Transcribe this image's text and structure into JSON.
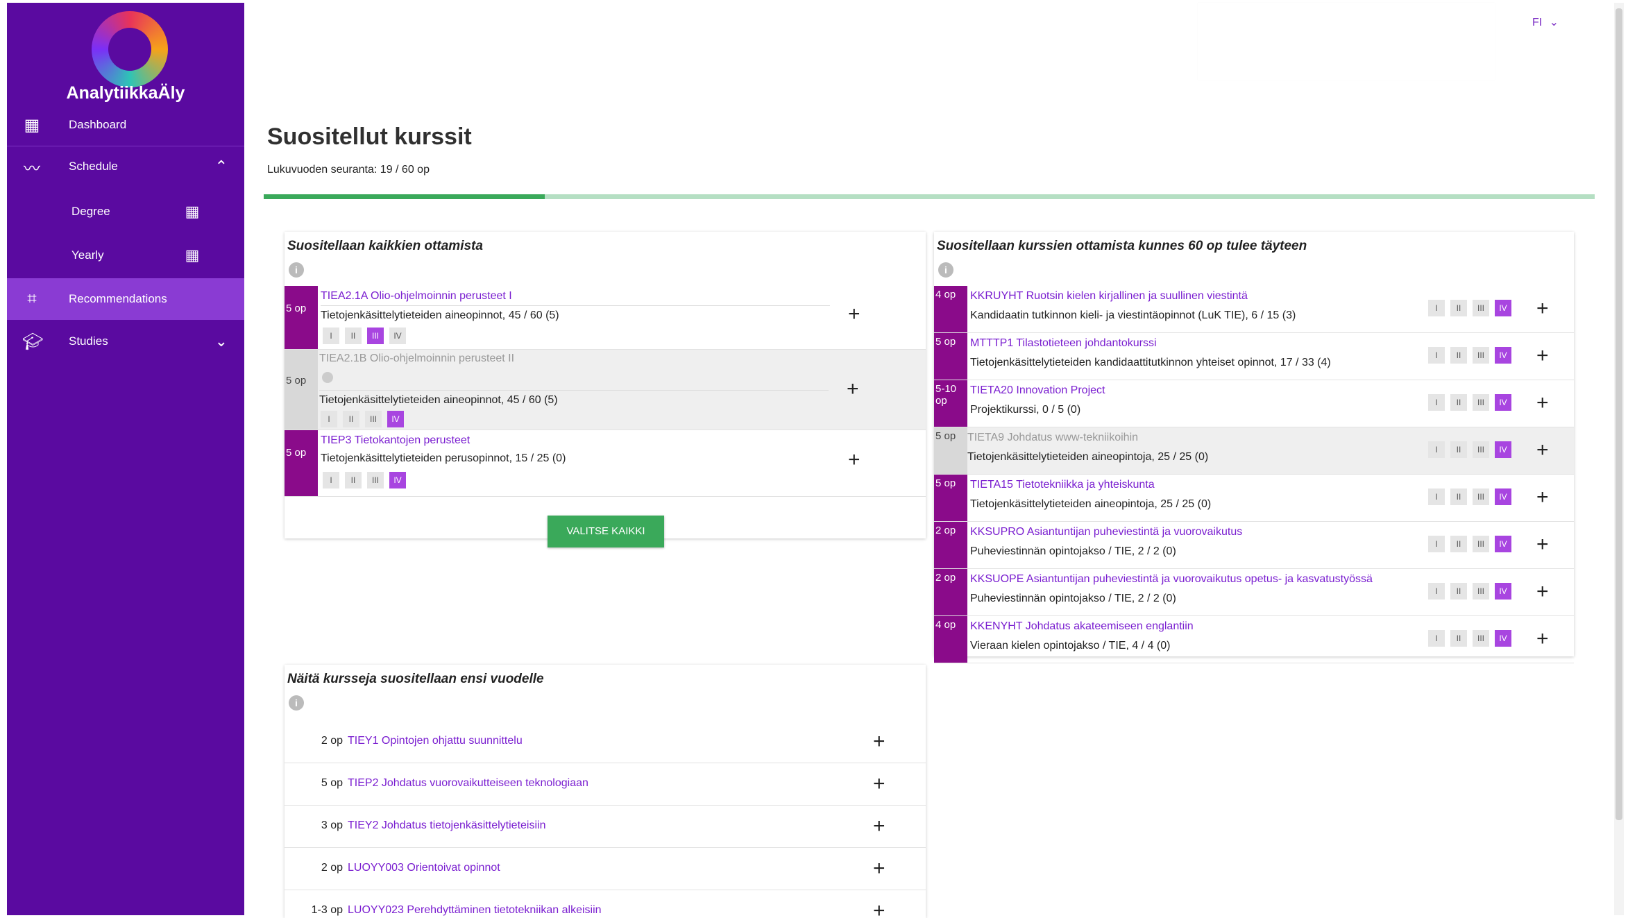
{
  "sidebar": {
    "brand": "AnalytiikkaÄly",
    "items": [
      {
        "label": "Dashboard"
      },
      {
        "label": "Schedule"
      },
      {
        "label": "Degree"
      },
      {
        "label": "Yearly"
      },
      {
        "label": "Recommendations"
      },
      {
        "label": "Studies"
      }
    ]
  },
  "header": {
    "lang": "FI"
  },
  "page": {
    "title": "Suositellut kurssit",
    "progress_label": "Lukuvuoden seuranta: 19 / 60 op",
    "progress_fraction": 0.211
  },
  "colors": {
    "sidebar": "#5a0aa0",
    "active": "#8a3bd3",
    "credit": "#8a0b8a",
    "accent": "#7a1ed0",
    "green": "#3aa95a"
  },
  "left_panel": {
    "title": "Suositellaan kaikkien ottamista",
    "button": "VALITSE KAIKKI",
    "courses": [
      {
        "credits": "5 op",
        "title": "TIEA2.1A Olio-ohjelmoinnin perusteet I",
        "sub": "Tietojenkäsittelytieteiden aineopinnot, 45 / 60 (5)"
      },
      {
        "credits": "5 op",
        "title": "TIEA2.1B Olio-ohjelmoinnin perusteet II",
        "sub": "Tietojenkäsittelytieteiden aineopinnot, 45 / 60 (5)"
      },
      {
        "credits": "5 op",
        "title": "TIEP3 Tietokantojen perusteet",
        "sub": "Tietojenkäsittelytieteiden perusopinnot, 15 / 25 (0)"
      }
    ]
  },
  "right_panel": {
    "title": "Suositellaan kurssien ottamista kunnes 60 op tulee täyteen",
    "courses": [
      {
        "credits": "4 op",
        "title": "KKRUYHT Ruotsin kielen kirjallinen ja suullinen viestintä",
        "sub": "Kandidaatin tutkinnon kieli- ja viestintäopinnot (LuK TIE), 6 / 15 (3)"
      },
      {
        "credits": "5 op",
        "title": "MTTTP1 Tilastotieteen johdantokurssi",
        "sub": "Tietojenkäsittelytieteiden kandidaattitutkinnon yhteiset opinnot, 17 / 33 (4)"
      },
      {
        "credits": "5-10 op",
        "title": "TIETA20 Innovation Project",
        "sub": "Projektikurssi, 0 / 5 (0)"
      },
      {
        "credits": "5 op",
        "title": "TIETA9 Johdatus www-tekniikoihin",
        "sub": "Tietojenkäsittelytieteiden aineopintoja, 25 / 25 (0)"
      },
      {
        "credits": "5 op",
        "title": "TIETA15 Tietotekniikka ja yhteiskunta",
        "sub": "Tietojenkäsittelytieteiden aineopintoja, 25 / 25 (0)"
      },
      {
        "credits": "2 op",
        "title": "KKSUPRO Asiantuntijan puheviestintä ja vuorovaikutus",
        "sub": "Puheviestinnän opintojakso / TIE, 2 / 2 (0)"
      },
      {
        "credits": "2 op",
        "title": "KKSUOPE Asiantuntijan puheviestintä ja vuorovaikutus opetus- ja kasvatustyössä",
        "sub": "Puheviestinnän opintojakso / TIE, 2 / 2 (0)"
      },
      {
        "credits": "4 op",
        "title": "KKENYHT Johdatus akateemiseen englantiin",
        "sub": "Vieraan kielen opintojakso / TIE, 4 / 4 (0)"
      }
    ]
  },
  "next_panel": {
    "title": "Näitä kursseja suositellaan ensi vuodelle",
    "courses": [
      {
        "credits": "2 op",
        "title": "TIEY1 Opintojen ohjattu suunnittelu"
      },
      {
        "credits": "5 op",
        "title": "TIEP2 Johdatus vuorovaikutteiseen teknologiaan"
      },
      {
        "credits": "3 op",
        "title": "TIEY2 Johdatus tietojenkäsittelytieteisiin"
      },
      {
        "credits": "2 op",
        "title": "LUOYY003 Orientoivat opinnot"
      },
      {
        "credits": "1-3 op",
        "title": "LUOYY023 Perehdyttäminen tietotekniikan alkeisiin"
      }
    ]
  },
  "periods": [
    "I",
    "II",
    "III",
    "IV"
  ],
  "icons": {
    "plus": "+",
    "info": "i",
    "chevron_up": "⌃",
    "chevron_down": "⌄",
    "caret": "⌄"
  }
}
